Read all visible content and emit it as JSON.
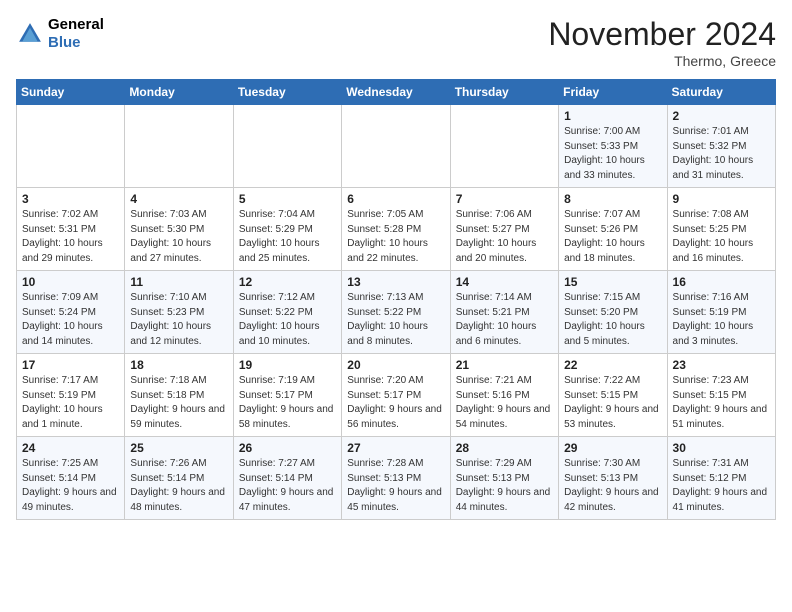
{
  "header": {
    "logo_line1": "General",
    "logo_line2": "Blue",
    "month": "November 2024",
    "location": "Thermo, Greece"
  },
  "days_of_week": [
    "Sunday",
    "Monday",
    "Tuesday",
    "Wednesday",
    "Thursday",
    "Friday",
    "Saturday"
  ],
  "weeks": [
    [
      {
        "day": "",
        "info": ""
      },
      {
        "day": "",
        "info": ""
      },
      {
        "day": "",
        "info": ""
      },
      {
        "day": "",
        "info": ""
      },
      {
        "day": "",
        "info": ""
      },
      {
        "day": "1",
        "info": "Sunrise: 7:00 AM\nSunset: 5:33 PM\nDaylight: 10 hours and 33 minutes."
      },
      {
        "day": "2",
        "info": "Sunrise: 7:01 AM\nSunset: 5:32 PM\nDaylight: 10 hours and 31 minutes."
      }
    ],
    [
      {
        "day": "3",
        "info": "Sunrise: 7:02 AM\nSunset: 5:31 PM\nDaylight: 10 hours and 29 minutes."
      },
      {
        "day": "4",
        "info": "Sunrise: 7:03 AM\nSunset: 5:30 PM\nDaylight: 10 hours and 27 minutes."
      },
      {
        "day": "5",
        "info": "Sunrise: 7:04 AM\nSunset: 5:29 PM\nDaylight: 10 hours and 25 minutes."
      },
      {
        "day": "6",
        "info": "Sunrise: 7:05 AM\nSunset: 5:28 PM\nDaylight: 10 hours and 22 minutes."
      },
      {
        "day": "7",
        "info": "Sunrise: 7:06 AM\nSunset: 5:27 PM\nDaylight: 10 hours and 20 minutes."
      },
      {
        "day": "8",
        "info": "Sunrise: 7:07 AM\nSunset: 5:26 PM\nDaylight: 10 hours and 18 minutes."
      },
      {
        "day": "9",
        "info": "Sunrise: 7:08 AM\nSunset: 5:25 PM\nDaylight: 10 hours and 16 minutes."
      }
    ],
    [
      {
        "day": "10",
        "info": "Sunrise: 7:09 AM\nSunset: 5:24 PM\nDaylight: 10 hours and 14 minutes."
      },
      {
        "day": "11",
        "info": "Sunrise: 7:10 AM\nSunset: 5:23 PM\nDaylight: 10 hours and 12 minutes."
      },
      {
        "day": "12",
        "info": "Sunrise: 7:12 AM\nSunset: 5:22 PM\nDaylight: 10 hours and 10 minutes."
      },
      {
        "day": "13",
        "info": "Sunrise: 7:13 AM\nSunset: 5:22 PM\nDaylight: 10 hours and 8 minutes."
      },
      {
        "day": "14",
        "info": "Sunrise: 7:14 AM\nSunset: 5:21 PM\nDaylight: 10 hours and 6 minutes."
      },
      {
        "day": "15",
        "info": "Sunrise: 7:15 AM\nSunset: 5:20 PM\nDaylight: 10 hours and 5 minutes."
      },
      {
        "day": "16",
        "info": "Sunrise: 7:16 AM\nSunset: 5:19 PM\nDaylight: 10 hours and 3 minutes."
      }
    ],
    [
      {
        "day": "17",
        "info": "Sunrise: 7:17 AM\nSunset: 5:19 PM\nDaylight: 10 hours and 1 minute."
      },
      {
        "day": "18",
        "info": "Sunrise: 7:18 AM\nSunset: 5:18 PM\nDaylight: 9 hours and 59 minutes."
      },
      {
        "day": "19",
        "info": "Sunrise: 7:19 AM\nSunset: 5:17 PM\nDaylight: 9 hours and 58 minutes."
      },
      {
        "day": "20",
        "info": "Sunrise: 7:20 AM\nSunset: 5:17 PM\nDaylight: 9 hours and 56 minutes."
      },
      {
        "day": "21",
        "info": "Sunrise: 7:21 AM\nSunset: 5:16 PM\nDaylight: 9 hours and 54 minutes."
      },
      {
        "day": "22",
        "info": "Sunrise: 7:22 AM\nSunset: 5:15 PM\nDaylight: 9 hours and 53 minutes."
      },
      {
        "day": "23",
        "info": "Sunrise: 7:23 AM\nSunset: 5:15 PM\nDaylight: 9 hours and 51 minutes."
      }
    ],
    [
      {
        "day": "24",
        "info": "Sunrise: 7:25 AM\nSunset: 5:14 PM\nDaylight: 9 hours and 49 minutes."
      },
      {
        "day": "25",
        "info": "Sunrise: 7:26 AM\nSunset: 5:14 PM\nDaylight: 9 hours and 48 minutes."
      },
      {
        "day": "26",
        "info": "Sunrise: 7:27 AM\nSunset: 5:14 PM\nDaylight: 9 hours and 47 minutes."
      },
      {
        "day": "27",
        "info": "Sunrise: 7:28 AM\nSunset: 5:13 PM\nDaylight: 9 hours and 45 minutes."
      },
      {
        "day": "28",
        "info": "Sunrise: 7:29 AM\nSunset: 5:13 PM\nDaylight: 9 hours and 44 minutes."
      },
      {
        "day": "29",
        "info": "Sunrise: 7:30 AM\nSunset: 5:13 PM\nDaylight: 9 hours and 42 minutes."
      },
      {
        "day": "30",
        "info": "Sunrise: 7:31 AM\nSunset: 5:12 PM\nDaylight: 9 hours and 41 minutes."
      }
    ]
  ]
}
